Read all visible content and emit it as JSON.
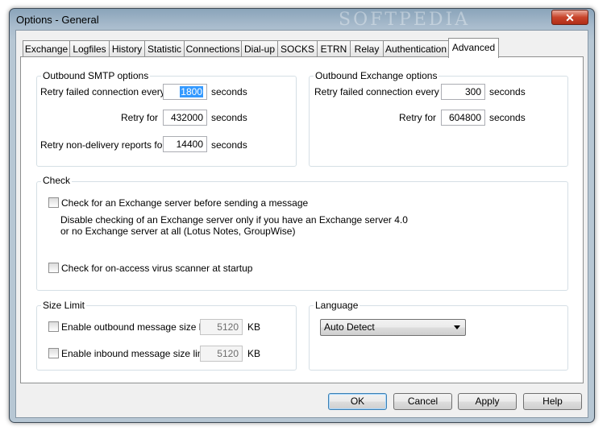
{
  "window": {
    "title": "Options - General",
    "watermark": "SOFTPEDIA",
    "close_glyph": "✕"
  },
  "tabs": [
    {
      "label": "Exchange"
    },
    {
      "label": "Logfiles"
    },
    {
      "label": "History"
    },
    {
      "label": "Statistic"
    },
    {
      "label": "Connections"
    },
    {
      "label": "Dial-up"
    },
    {
      "label": "SOCKS"
    },
    {
      "label": "ETRN"
    },
    {
      "label": "Relay"
    },
    {
      "label": "Authentication"
    },
    {
      "label": "Advanced"
    }
  ],
  "active_tab": "Advanced",
  "smtp": {
    "title": "Outbound SMTP options",
    "retry_every_label": "Retry failed connection every",
    "retry_every_value": "1800",
    "retry_for_label": "Retry for",
    "retry_for_value": "432000",
    "nondelivery_label": "Retry non-delivery reports for",
    "nondelivery_value": "14400",
    "unit": "seconds"
  },
  "exchange": {
    "title": "Outbound Exchange options",
    "retry_every_label": "Retry failed connection every",
    "retry_every_value": "300",
    "retry_for_label": "Retry for",
    "retry_for_value": "604800",
    "unit": "seconds"
  },
  "check": {
    "title": "Check",
    "exchange_label": "Check for an Exchange server before sending a message",
    "exchange_checked": false,
    "note_line1": "Disable checking of an Exchange server only if you have an Exchange server 4.0",
    "note_line2": "or no Exchange server at all (Lotus Notes, GroupWise)",
    "virus_label": "Check for on-access virus scanner at startup",
    "virus_checked": false
  },
  "size_limit": {
    "title": "Size Limit",
    "outbound_label": "Enable outbound message size limit:",
    "outbound_value": "5120",
    "outbound_checked": false,
    "inbound_label": "Enable inbound message size limit:",
    "inbound_value": "5120",
    "inbound_checked": false,
    "unit": "KB"
  },
  "language": {
    "title": "Language",
    "selected": "Auto Detect"
  },
  "buttons": {
    "ok": "OK",
    "cancel": "Cancel",
    "apply": "Apply",
    "help": "Help"
  }
}
